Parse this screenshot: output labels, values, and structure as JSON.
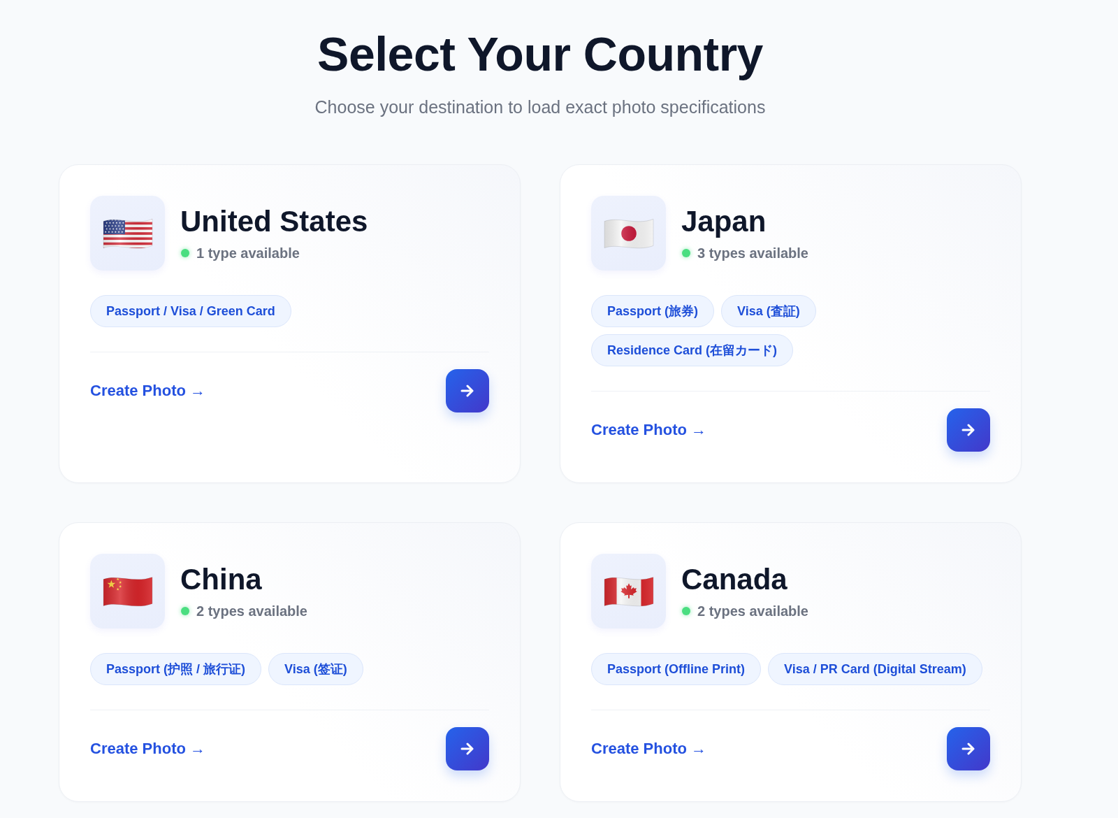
{
  "header": {
    "title": "Select Your Country",
    "subtitle": "Choose your destination to load exact photo specifications"
  },
  "countries": [
    {
      "kind": "us",
      "name": "United States",
      "availability": "1 type available",
      "tags": [
        "Passport / Visa / Green Card"
      ],
      "link": "Create Photo →"
    },
    {
      "kind": "jp",
      "name": "Japan",
      "availability": "3 types available",
      "tags": [
        "Passport (旅券)",
        "Visa (査証)",
        "Residence Card (在留カード)"
      ],
      "link": "Create Photo →"
    },
    {
      "kind": "cn",
      "name": "China",
      "availability": "2 types available",
      "tags": [
        "Passport (护照 / 旅行证)",
        "Visa (签证)"
      ],
      "link": "Create Photo →"
    },
    {
      "kind": "ca",
      "name": "Canada",
      "availability": "2 types available",
      "tags": [
        "Passport (Offline Print)",
        "Visa / PR Card (Digital Stream)"
      ],
      "link": "Create Photo →"
    }
  ]
}
